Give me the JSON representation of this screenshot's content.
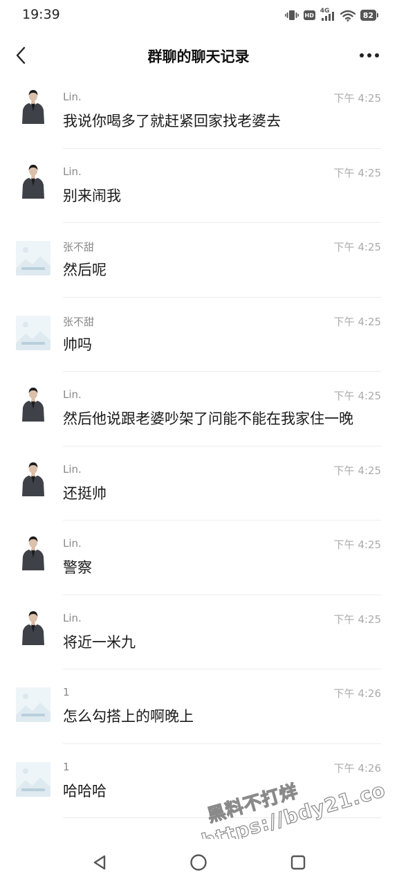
{
  "status_bar": {
    "time": "19:39",
    "hd_label": "HD",
    "network": "4G",
    "battery": "82",
    "icons": [
      "vibrate-icon",
      "hd-icon",
      "signal-icon",
      "wifi-icon",
      "battery-icon"
    ]
  },
  "header": {
    "title": "群聊的聊天记录",
    "back_icon": "chevron-left-icon",
    "more_icon": "more-dots-icon"
  },
  "messages": [
    {
      "sender": "Lin.",
      "time": "下午 4:25",
      "text": "我说你喝多了就赶紧回家找老婆去",
      "avatar": "photo"
    },
    {
      "sender": "Lin.",
      "time": "下午 4:25",
      "text": "别来闹我",
      "avatar": "photo"
    },
    {
      "sender": "张不甜",
      "time": "下午 4:25",
      "text": "然后呢",
      "avatar": "placeholder"
    },
    {
      "sender": "张不甜",
      "time": "下午 4:25",
      "text": "帅吗",
      "avatar": "placeholder"
    },
    {
      "sender": "Lin.",
      "time": "下午 4:25",
      "text": "然后他说跟老婆吵架了问能不能在我家住一晚",
      "avatar": "photo"
    },
    {
      "sender": "Lin.",
      "time": "下午 4:25",
      "text": "还挺帅",
      "avatar": "photo"
    },
    {
      "sender": "Lin.",
      "time": "下午 4:25",
      "text": "警察",
      "avatar": "photo"
    },
    {
      "sender": "Lin.",
      "time": "下午 4:25",
      "text": "将近一米九",
      "avatar": "photo"
    },
    {
      "sender": "1",
      "time": "下午 4:26",
      "text": "怎么勾搭上的啊晚上",
      "avatar": "placeholder"
    },
    {
      "sender": "1",
      "time": "下午 4:26",
      "text": "哈哈哈",
      "avatar": "placeholder"
    }
  ],
  "watermark": {
    "line1": "黑料不打烊",
    "line2": "https://bdy21.co"
  },
  "nav_bar": {
    "icons": [
      "back-triangle-icon",
      "home-circle-icon",
      "recents-square-icon"
    ]
  }
}
